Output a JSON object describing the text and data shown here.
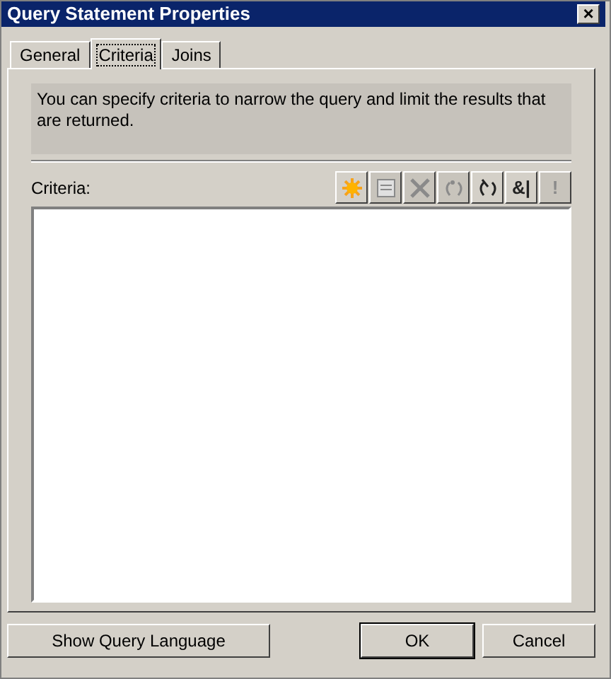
{
  "window": {
    "title": "Query Statement Properties",
    "close": "×"
  },
  "tabs": [
    {
      "label": "General",
      "selected": false
    },
    {
      "label": "Criteria",
      "selected": true
    },
    {
      "label": "Joins",
      "selected": false
    }
  ],
  "description": "You can specify criteria to narrow the query and limit the results that are returned.",
  "criteria": {
    "label": "Criteria:"
  },
  "toolbar": [
    {
      "kind": "sun",
      "disabled": false
    },
    {
      "kind": "document",
      "disabled": true
    },
    {
      "kind": "delete",
      "disabled": true
    },
    {
      "kind": "sparkle-parens",
      "disabled": true
    },
    {
      "kind": "arrow-parens",
      "disabled": false
    },
    {
      "kind": "text",
      "text": "&|",
      "disabled": false
    },
    {
      "kind": "text",
      "text": "!",
      "disabled": true
    }
  ],
  "buttons": [
    {
      "label": "Show Query Language",
      "default": false
    },
    {
      "label": "OK",
      "default": true
    },
    {
      "label": "Cancel",
      "default": false
    }
  ]
}
